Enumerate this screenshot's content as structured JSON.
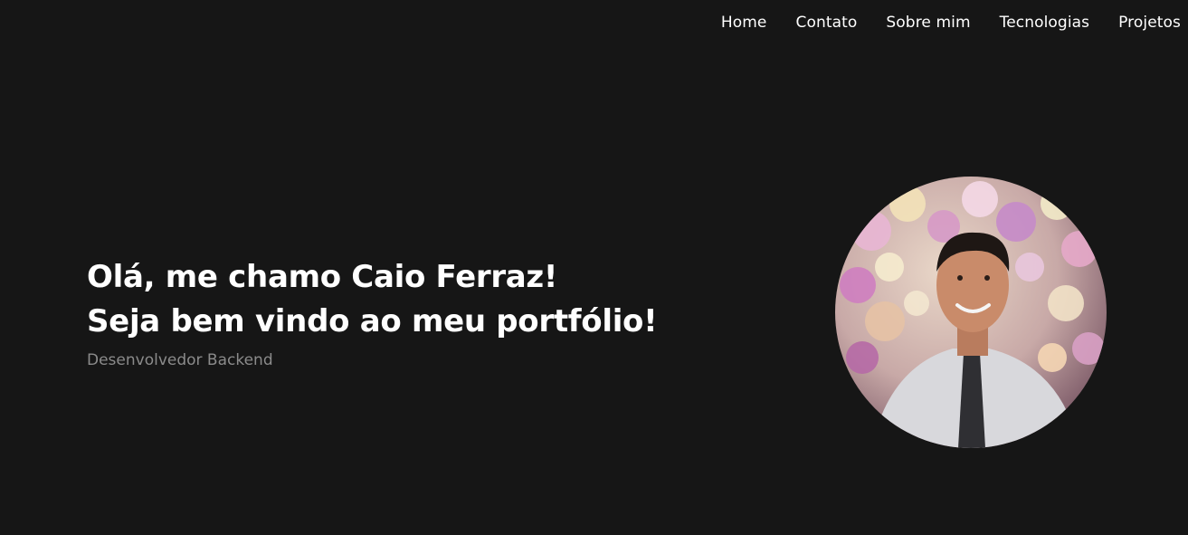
{
  "nav": {
    "items": [
      {
        "label": "Home"
      },
      {
        "label": "Contato"
      },
      {
        "label": "Sobre mim"
      },
      {
        "label": "Tecnologias"
      },
      {
        "label": "Projetos"
      }
    ]
  },
  "hero": {
    "heading_line1": "Olá, me chamo Caio Ferraz!",
    "heading_line2": "Seja bem vindo ao meu portfólio!",
    "subtitle": "Desenvolvedor Backend"
  },
  "colors": {
    "background": "#161616",
    "text": "#ffffff",
    "subtitle": "#8b8b8b"
  }
}
